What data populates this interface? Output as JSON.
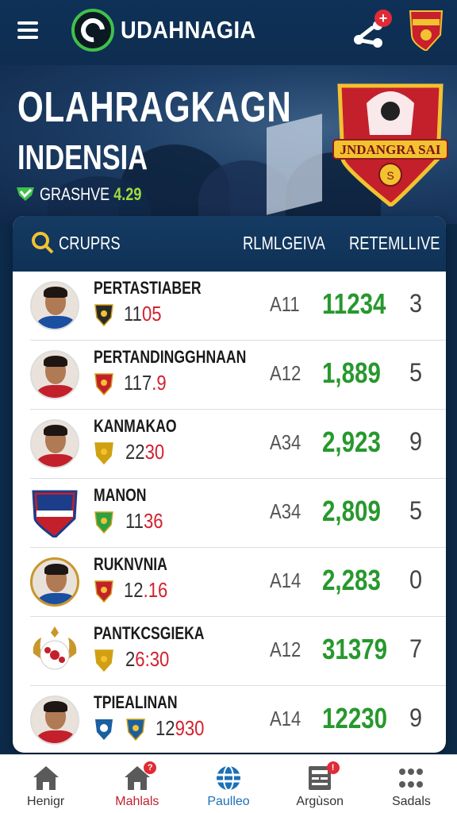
{
  "header": {
    "app_title": "UDAHNAGIA",
    "notification_badge": "+",
    "colors": {
      "bar": "#0f3157",
      "logo_ring": "#3fc14b"
    }
  },
  "hero": {
    "title": "OLAHRAGKAGN",
    "subtitle": "INDENSIA",
    "status_label": "GRASHVE",
    "status_value": "4.29",
    "crest_text": "JNDANGRA SAI",
    "crest_text_small": "S"
  },
  "table": {
    "col_groups": "CRUPRS",
    "col_reg": "RLMLGEIVA",
    "col_live": "RETEMLLIVE",
    "rows": [
      {
        "name": "PERTASTIABER",
        "score_a": "11",
        "score_b": "05",
        "code": "A11",
        "points": "11234",
        "live": "3",
        "avatar": "player",
        "shirt": "#1b4fa0"
      },
      {
        "name": "PERTANDINGGHNAAN",
        "score_a": "117",
        "score_b": ".9",
        "code": "A12",
        "points": "1,889",
        "live": "5",
        "avatar": "player",
        "shirt": "#c3202c"
      },
      {
        "name": "KANMAKAO",
        "score_a": "22",
        "score_b": "30",
        "code": "A34",
        "points": "2,923",
        "live": "9",
        "avatar": "player",
        "shirt": "#c3202c"
      },
      {
        "name": "MANON",
        "score_a": "11",
        "score_b": "36",
        "code": "A34",
        "points": "2,809",
        "live": "5",
        "avatar": "crest",
        "shirt": "#c3202c"
      },
      {
        "name": "RUKNVNIA",
        "score_a": "12",
        "score_b": ".16",
        "code": "A14",
        "points": "2,283",
        "live": "0",
        "avatar": "player-gold",
        "shirt": "#1b4fa0"
      },
      {
        "name": "PANTKCSGIEKA",
        "score_a": "2",
        "score_b": "6:30",
        "code": "A12",
        "points": "31379",
        "live": "7",
        "avatar": "ball",
        "shirt": "#c3202c"
      },
      {
        "name": "TPIEALINAN",
        "score_a": "12",
        "score_b": "930",
        "code": "A14",
        "points": "12230",
        "live": "9",
        "avatar": "player",
        "shirt": "#c3202c"
      }
    ]
  },
  "bottom_nav": [
    {
      "label": "Henigr",
      "icon": "home-icon"
    },
    {
      "label": "Mahlals",
      "icon": "home-alert-icon",
      "dot": "?"
    },
    {
      "label": "Paulleo",
      "icon": "globe-icon"
    },
    {
      "label": "Argùson",
      "icon": "news-icon",
      "dot": "!"
    },
    {
      "label": "Sadals",
      "icon": "grid-icon"
    }
  ]
}
